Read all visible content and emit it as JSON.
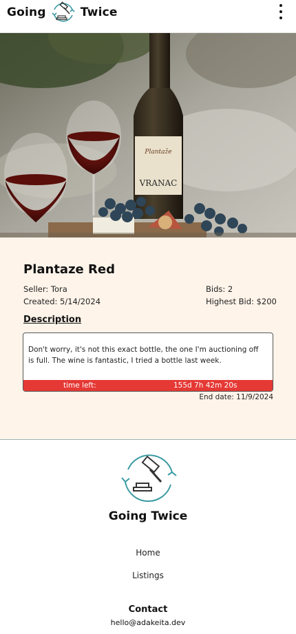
{
  "header": {
    "brand_left": "Going",
    "brand_right": "Twice",
    "menu_icon": "more-vertical-icon"
  },
  "hero": {
    "alt": "Bottle of Vranac wine with glasses, grapes and figs",
    "bottle_label": "VRANAC"
  },
  "listing": {
    "title": "Plantaze Red",
    "seller": "Seller: Tora",
    "created": "Created: 5/14/2024",
    "bids": "Bids: 2",
    "highest_bid": "Highest Bid: $200",
    "description_label": "Description",
    "description": "Don't worry, it's not this exact bottle, the one I'm auctioning off is full. The wine is fantastic, I tried a bottle last week.",
    "time_left_label": "time left:",
    "time_left_value": "155d 7h 42m 20s",
    "end_date": "End date: 11/9/2024"
  },
  "footer": {
    "brand": "Going Twice",
    "nav": [
      "Home",
      "Listings"
    ],
    "contact_heading": "Contact",
    "contact_email": "hello@adakeita.dev"
  },
  "colors": {
    "accent_teal": "#3a9aa3",
    "timer_red": "#e53935",
    "listing_bg": "#fef4ea"
  }
}
